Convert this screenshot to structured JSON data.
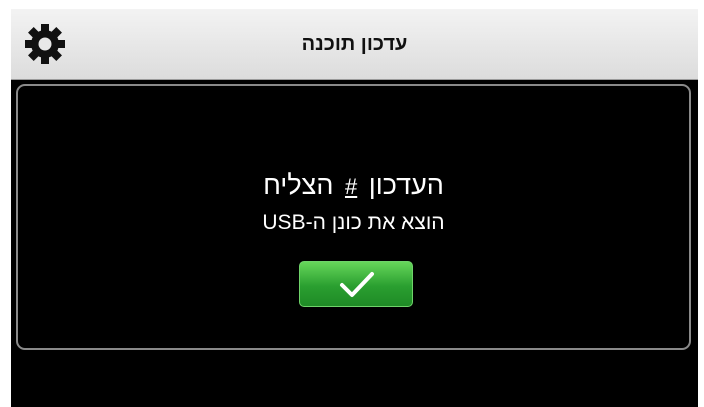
{
  "header": {
    "title": "עדכון תוכנה",
    "settings_icon": "gear-icon"
  },
  "dialog": {
    "message_start": "העדכון",
    "message_placeholder": "#",
    "message_end": "הצליח",
    "instruction": "הוצא את כונן ה-USB",
    "confirm_icon": "checkmark-icon"
  },
  "colors": {
    "background": "#000000",
    "header": "#e6e6e6",
    "confirm_button": "#2ea336",
    "text": "#ffffff"
  }
}
